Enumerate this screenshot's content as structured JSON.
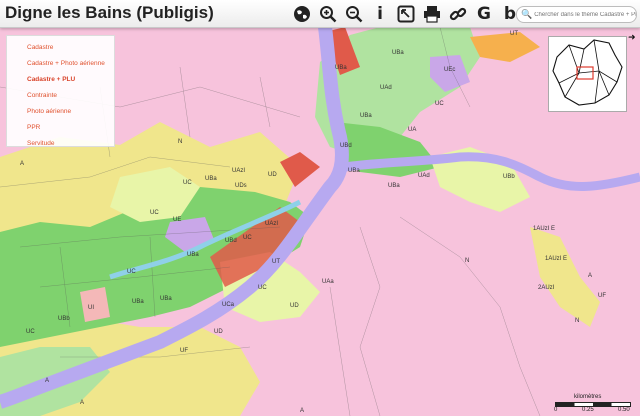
{
  "app": {
    "title": "Digne les Bains (Publigis)"
  },
  "toolbar": {
    "icons": [
      "globe-icon",
      "zoom-in-icon",
      "zoom-out-icon",
      "info-icon",
      "pointer-icon",
      "print-icon",
      "link-icon",
      "google-icon",
      "bing-icon"
    ]
  },
  "search": {
    "placeholder": "Chercher dans le thème Cadastre + PLU",
    "value": ""
  },
  "themes": {
    "active": "Cadastre + PLU",
    "items": [
      {
        "label": "Cadastre"
      },
      {
        "label": "Cadastre + Photo aérienne"
      },
      {
        "label": "Cadastre + PLU"
      },
      {
        "label": "Contrainte"
      },
      {
        "label": "Photo aérienne"
      },
      {
        "label": "PPR"
      },
      {
        "label": "Servitude"
      }
    ]
  },
  "overview": {
    "toggle_icon": "arrow-right-icon"
  },
  "scale": {
    "title": "kilomètres",
    "ticks": [
      "0",
      "0.25",
      "0.50"
    ]
  },
  "zones": {
    "labels": [
      "UBa",
      "UBa",
      "UAd",
      "UBd",
      "UBa",
      "UBa",
      "UC",
      "UBa",
      "UC",
      "UBa",
      "UBa",
      "UBd",
      "UC",
      "UI",
      "UD",
      "UBa",
      "UE",
      "UDs",
      "UAd",
      "1AUzI E",
      "1AUzI E",
      "N",
      "N",
      "A",
      "A",
      "A",
      "A",
      "UBb",
      "UF",
      "UF",
      "UD",
      "UC",
      "UC",
      "UAzI",
      "UAzI",
      "UT",
      "UEc",
      "UT",
      "UBa",
      "UCa",
      "UC",
      "UD",
      "UAa",
      "2AUzI",
      "UA",
      "A",
      "UBb",
      "UC",
      "N"
    ]
  },
  "colors": {
    "zone_n": "#f7c3dc",
    "zone_a": "#f0e68c",
    "zone_ua": "#7fd26e",
    "zone_ub": "#b0e3a0",
    "zone_uc": "#e8f5a8",
    "zone_ud": "#f4b8b8",
    "zone_ue": "#c9a7e8",
    "zone_ui": "#f6b04d",
    "zone_red": "#e05a4a",
    "river": "#b7a9f0",
    "parcel_line": "#555555"
  }
}
